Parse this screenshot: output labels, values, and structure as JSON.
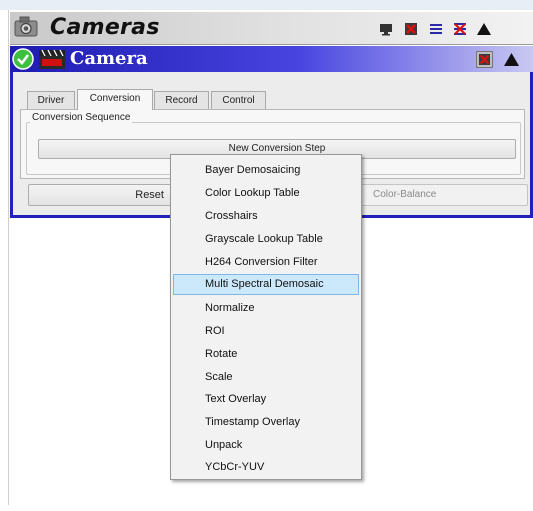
{
  "cameras_window": {
    "title": "Cameras",
    "icon": "camera-icon",
    "toolbar_icons": [
      "monitor-icon",
      "film-close-icon",
      "menu-icon",
      "close-x-icon",
      "eject-icon"
    ]
  },
  "camera_window": {
    "title": "Camera",
    "status_icon": "checkmark-icon",
    "app_icon": "live-clapper-icon",
    "toolbar_icons": [
      "film-close-icon",
      "eject-icon"
    ]
  },
  "tabs": [
    {
      "label": "Driver",
      "active": false
    },
    {
      "label": "Conversion",
      "active": true
    },
    {
      "label": "Record",
      "active": false
    },
    {
      "label": "Control",
      "active": false
    }
  ],
  "conversion": {
    "group_label": "Conversion Sequence",
    "new_step_button": "New Conversion Step"
  },
  "bottom_buttons": {
    "reset": "Reset",
    "color_balance": "Color-Balance"
  },
  "menu": {
    "highlighted_index": 5,
    "items": [
      "Bayer Demosaicing",
      "Color Lookup Table",
      "Crosshairs",
      "Grayscale Lookup Table",
      "H264 Conversion Filter",
      "Multi Spectral Demosaic",
      "Normalize",
      "ROI",
      "Rotate",
      "Scale",
      "Text Overlay",
      "Timestamp Overlay",
      "Unpack",
      "YCbCr-YUV"
    ]
  },
  "colors": {
    "title_bar_blue": "#1d1bb0",
    "menu_highlight": "#cce8fb",
    "menu_highlight_border": "#7fb6e3"
  }
}
